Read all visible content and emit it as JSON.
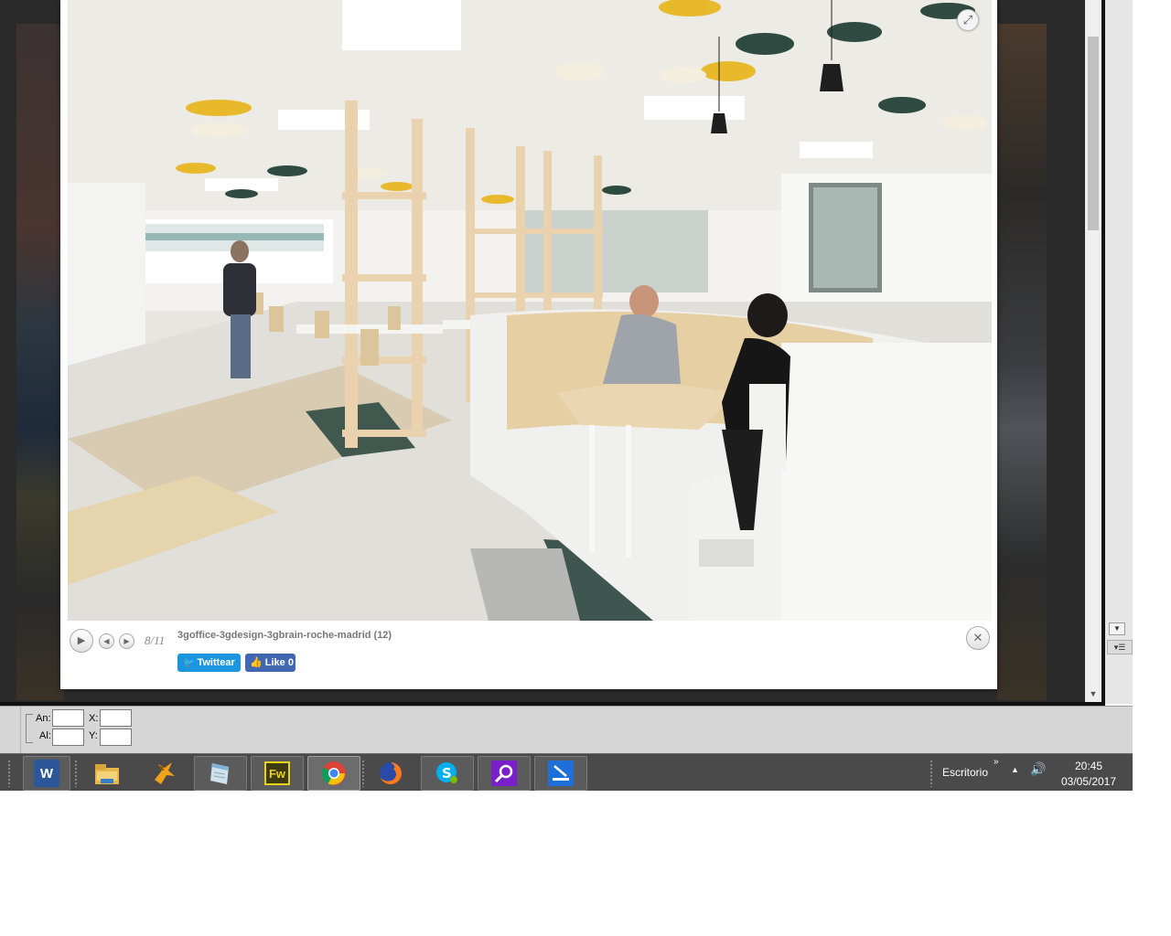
{
  "lightbox": {
    "counter": "8/11",
    "caption": "3goffice-3gdesign-3gbrain-roche-madrid (12)",
    "tweet_label": "Twittear",
    "like_label": "Like 0"
  },
  "properties": {
    "width_label": "An:",
    "height_label": "Al:",
    "x_label": "X:",
    "y_label": "Y:",
    "width_value": "",
    "height_value": "",
    "x_value": "",
    "y_value": ""
  },
  "taskbar": {
    "apps": [
      "word-icon",
      "file-explorer-icon",
      "app-x-icon",
      "notepad-icon",
      "fireworks-icon",
      "chrome-icon",
      "firefox-icon",
      "skype-icon",
      "search-app-icon",
      "scanner-icon"
    ],
    "fireworks_label": "Fw",
    "word_label": "W",
    "tray_label": "Escritorio",
    "tray_chevron": "»",
    "time": "20:45",
    "date": "03/05/2017"
  },
  "colors": {
    "taskbar": "#4a4a4a",
    "twitter": "#1b95e0",
    "facebook": "#4267b2",
    "fireworks_bg": "#3d3a10",
    "fireworks_fg": "#e8d21c",
    "skype": "#00aff0",
    "word": "#2b579a"
  }
}
